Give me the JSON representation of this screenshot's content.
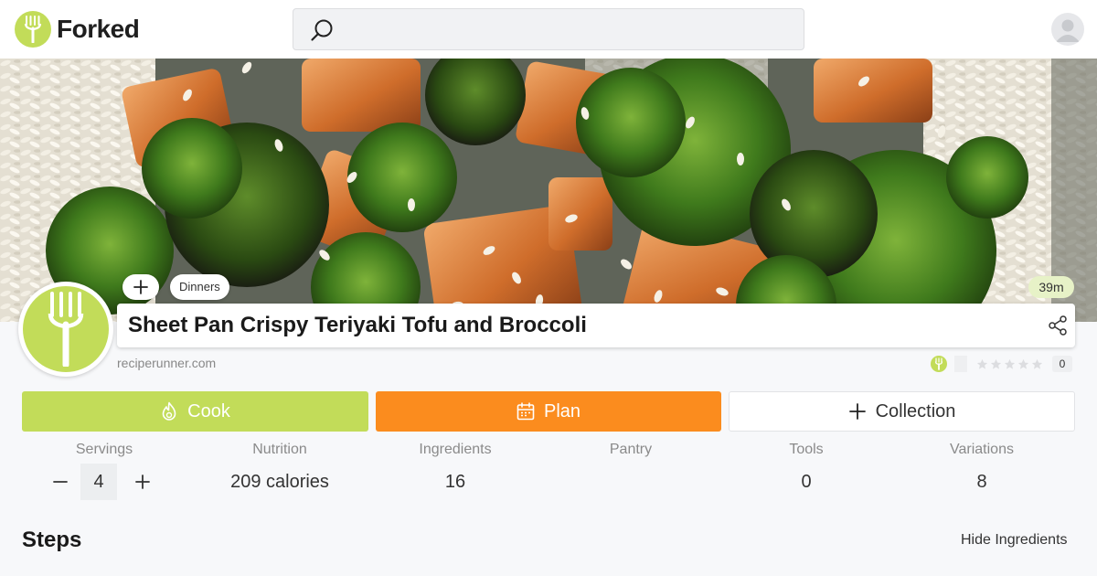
{
  "header": {
    "brand_name": "Forked",
    "search_placeholder": ""
  },
  "recipe": {
    "title": "Sheet Pan Crispy Teriyaki Tofu and Broccoli",
    "tag": "Dinners",
    "time": "39m",
    "source": "reciperunner.com",
    "rating_count": "0"
  },
  "actions": {
    "cook_label": "Cook",
    "plan_label": "Plan",
    "collection_label": "Collection"
  },
  "stats": {
    "servings_label": "Servings",
    "servings_value": "4",
    "nutrition_label": "Nutrition",
    "nutrition_value": "209 calories",
    "ingredients_label": "Ingredients",
    "ingredients_value": "16",
    "pantry_label": "Pantry",
    "pantry_value": "",
    "tools_label": "Tools",
    "tools_value": "0",
    "variations_label": "Variations",
    "variations_value": "8"
  },
  "steps": {
    "heading": "Steps",
    "hide_ingredients_label": "Hide Ingredients"
  },
  "colors": {
    "brand_green": "#c2dc59",
    "plan_orange": "#fb8c1e",
    "time_chip_bg": "#e7f2c7"
  },
  "icons": [
    "fork-icon",
    "search-icon",
    "user-icon",
    "plus-icon",
    "share-icon",
    "star-icon",
    "flame-icon",
    "calendar-icon",
    "minus-icon"
  ]
}
